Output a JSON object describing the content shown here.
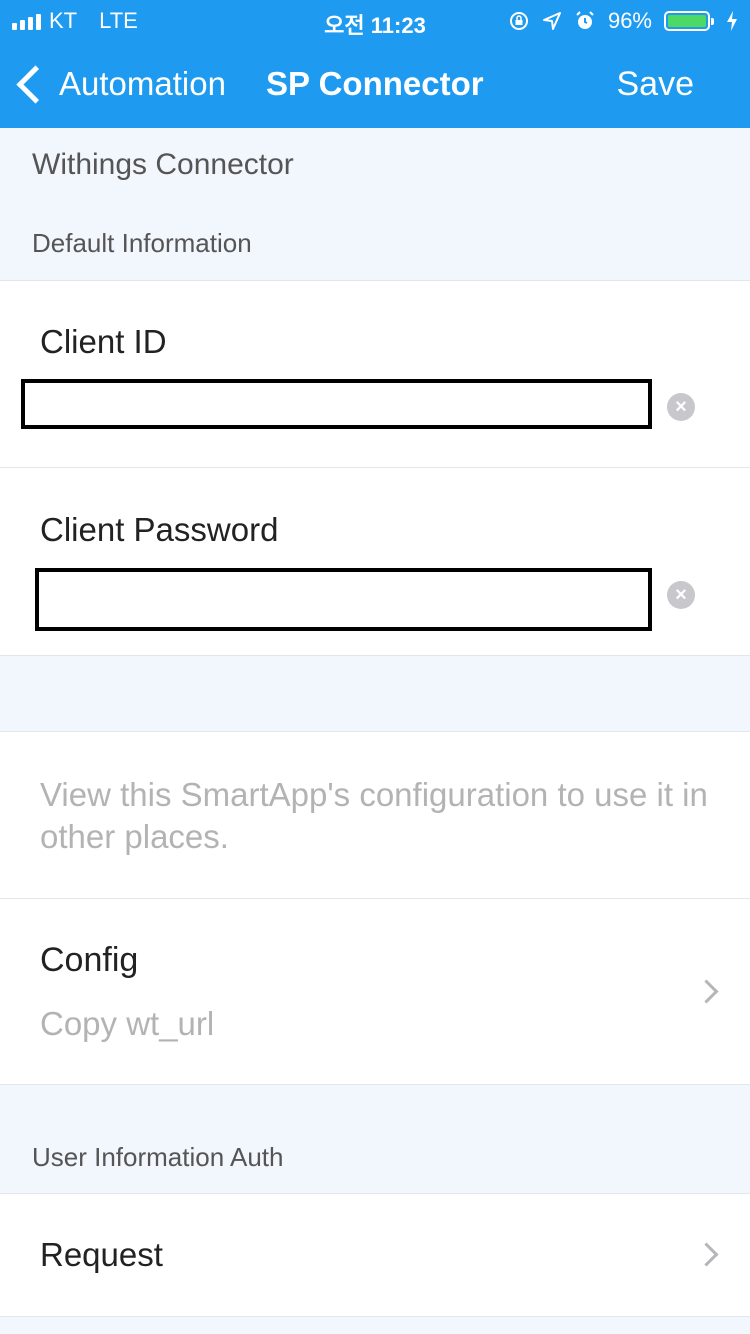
{
  "status_bar": {
    "carrier": "KT",
    "network": "LTE",
    "time": "오전 11:23",
    "battery_percent": "96%",
    "icons": [
      "signal-icon",
      "lock-rotation-icon",
      "location-icon",
      "alarm-icon",
      "battery-icon",
      "charging-icon"
    ]
  },
  "nav": {
    "back_label": "Automation",
    "title": "SP Connector",
    "save_label": "Save"
  },
  "app_name": "Withings Connector",
  "sections": {
    "default_info": "Default Information",
    "user_auth": "User Information Auth"
  },
  "fields": {
    "client_id": {
      "label": "Client ID",
      "value": ""
    },
    "client_password": {
      "label": "Client Password",
      "value": ""
    }
  },
  "config": {
    "description": "View this SmartApp's configuration to use it in other places.",
    "title": "Config",
    "subtitle": "Copy wt_url"
  },
  "request": {
    "label": "Request"
  },
  "colors": {
    "accent": "#1e9bf0",
    "background": "#f2f6fd",
    "battery": "#4cd964"
  }
}
